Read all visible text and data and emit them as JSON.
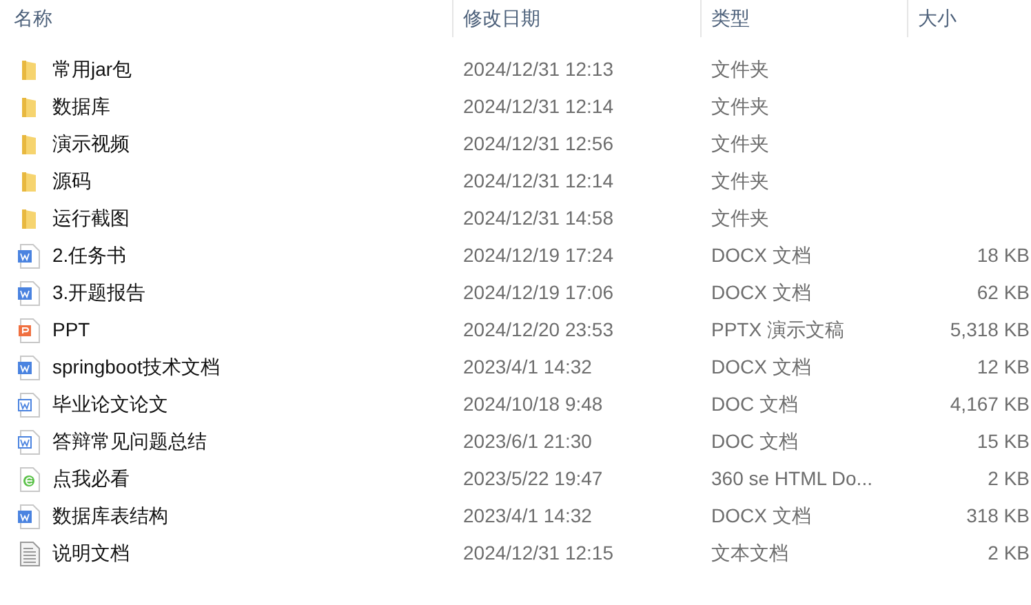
{
  "columns": [
    "名称",
    "修改日期",
    "类型",
    "大小"
  ],
  "rows": [
    {
      "kind": "folder",
      "name": "常用jar包",
      "date": "2024/12/31 12:13",
      "type": "文件夹"
    },
    {
      "kind": "folder",
      "name": "数据库",
      "date": "2024/12/31 12:14",
      "type": "文件夹"
    },
    {
      "kind": "folder",
      "name": "演示视频",
      "date": "2024/12/31 12:56",
      "type": "文件夹"
    },
    {
      "kind": "folder",
      "name": "源码",
      "date": "2024/12/31 12:14",
      "type": "文件夹"
    },
    {
      "kind": "folder",
      "name": "运行截图",
      "date": "2024/12/31 14:58",
      "type": "文件夹"
    },
    {
      "kind": "docx",
      "name": "2.任务书",
      "date": "2024/12/19 17:24",
      "type": "DOCX 文档",
      "size": "18 KB"
    },
    {
      "kind": "docx",
      "name": "3.开题报告",
      "date": "2024/12/19 17:06",
      "type": "DOCX 文档",
      "size": "62 KB"
    },
    {
      "kind": "pptx",
      "name": "PPT",
      "date": "2024/12/20 23:53",
      "type": "PPTX 演示文稿",
      "size": "5,318 KB"
    },
    {
      "kind": "docx",
      "name": "springboot技术文档",
      "date": "2023/4/1 14:32",
      "type": "DOCX 文档",
      "size": "12 KB"
    },
    {
      "kind": "doc",
      "name": "毕业论文论文",
      "date": "2024/10/18 9:48",
      "type": "DOC 文档",
      "size": "4,167 KB"
    },
    {
      "kind": "doc",
      "name": "答辩常见问题总结",
      "date": "2023/6/1 21:30",
      "type": "DOC 文档",
      "size": "15 KB"
    },
    {
      "kind": "html",
      "name": "点我必看",
      "date": "2023/5/22 19:47",
      "type": "360 se HTML Do...",
      "size": "2 KB"
    },
    {
      "kind": "docx",
      "name": "数据库表结构",
      "date": "2023/4/1 14:32",
      "type": "DOCX 文档",
      "size": "318 KB"
    },
    {
      "kind": "txt",
      "name": "说明文档",
      "date": "2024/12/31 12:15",
      "type": "文本文档",
      "size": "2 KB"
    }
  ]
}
